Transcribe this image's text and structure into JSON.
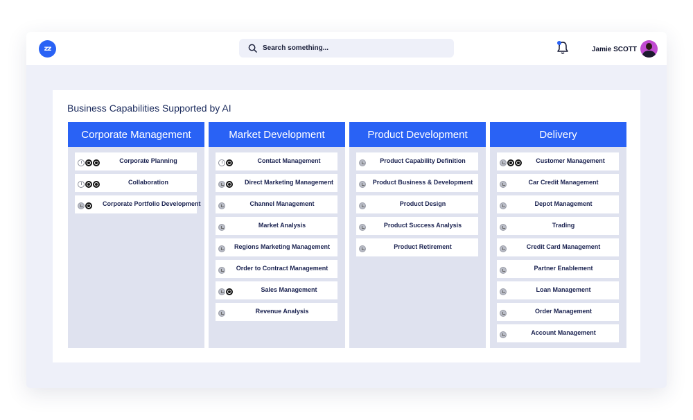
{
  "header": {
    "logo_text": "zz",
    "search_placeholder": "Search something...",
    "username": "Jamie SCOTT"
  },
  "panel": {
    "title": "Business Capabilities Supported by AI"
  },
  "columns": [
    {
      "title": "Corporate Management",
      "items": [
        {
          "label": "Corporate Planning",
          "icons": [
            "clock-icon",
            "swirl-icon",
            "swirl-icon"
          ]
        },
        {
          "label": "Collaboration",
          "icons": [
            "clock-icon",
            "swirl-icon",
            "swirl-icon"
          ]
        },
        {
          "label": "Corporate Portfolio Development",
          "icons": [
            "status-icon",
            "swirl-icon"
          ]
        }
      ]
    },
    {
      "title": "Market Development",
      "items": [
        {
          "label": "Contact Management",
          "icons": [
            "clock-icon",
            "swirl-icon"
          ]
        },
        {
          "label": "Direct Marketing Management",
          "icons": [
            "status-icon",
            "swirl-icon"
          ]
        },
        {
          "label": "Channel Management",
          "icons": [
            "status-icon"
          ]
        },
        {
          "label": "Market Analysis",
          "icons": [
            "status-icon"
          ]
        },
        {
          "label": "Regions Marketing Management",
          "icons": [
            "status-icon"
          ]
        },
        {
          "label": "Order to Contract Management",
          "icons": [
            "status-icon"
          ]
        },
        {
          "label": "Sales Management",
          "icons": [
            "status-icon",
            "swirl-icon"
          ]
        },
        {
          "label": "Revenue Analysis",
          "icons": [
            "status-icon"
          ]
        }
      ]
    },
    {
      "title": "Product Development",
      "items": [
        {
          "label": "Product Capability Definition",
          "icons": [
            "status-icon"
          ]
        },
        {
          "label": "Product  Business & Development",
          "icons": [
            "status-icon"
          ]
        },
        {
          "label": "Product Design",
          "icons": [
            "status-icon"
          ]
        },
        {
          "label": "Product Success Analysis",
          "icons": [
            "status-icon"
          ]
        },
        {
          "label": "Product Retirement",
          "icons": [
            "status-icon"
          ]
        }
      ]
    },
    {
      "title": "Delivery",
      "items": [
        {
          "label": "Customer Management",
          "icons": [
            "status-icon",
            "swirl-icon",
            "swirl-icon"
          ]
        },
        {
          "label": "Car Credit Management",
          "icons": [
            "status-icon"
          ]
        },
        {
          "label": "Depot Management",
          "icons": [
            "status-icon"
          ]
        },
        {
          "label": "Trading",
          "icons": [
            "status-icon"
          ]
        },
        {
          "label": "Credit Card Management",
          "icons": [
            "status-icon"
          ]
        },
        {
          "label": "Partner Enablement",
          "icons": [
            "status-icon"
          ]
        },
        {
          "label": "Loan Management",
          "icons": [
            "status-icon"
          ]
        },
        {
          "label": "Order Management",
          "icons": [
            "status-icon"
          ]
        },
        {
          "label": "Account Management",
          "icons": [
            "status-icon"
          ]
        }
      ]
    }
  ],
  "colors": {
    "accent": "#2962f5",
    "column_bg": "#dfe2ef",
    "window_bg": "#eef0f9"
  }
}
